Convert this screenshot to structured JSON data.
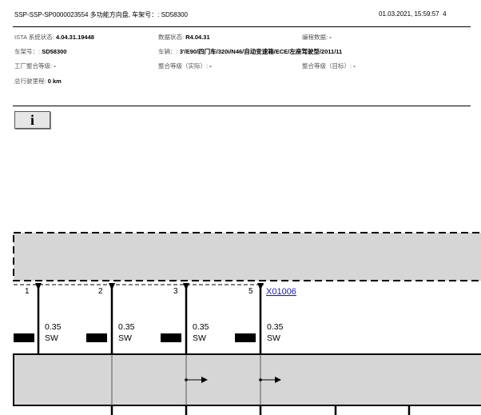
{
  "header": {
    "doc_title": "SSP-SSP-SP0000023554 多功能方向盘, 车架号：: SD58300",
    "datetime": "01.03.2021, 15:59:57",
    "page_no": "4"
  },
  "vehicle_info": {
    "ista_label": "ISTA 系统状态:",
    "ista_value": "4.04.31.19448",
    "data_status_label": "数据状态:",
    "data_status_value": "R4.04.31",
    "programming_label": "编程数据:",
    "programming_value": "-",
    "vin_label": "车架号：:",
    "vin_value": "SD58300",
    "vehicle_label": "车辆：:",
    "vehicle_value": "3'/E90/四门车/320i/N46/自动变速箱/ECE/左座驾驶型/2011/11",
    "factory_level_label": "工厂整合等级:",
    "factory_level_value": "-",
    "actual_level_label": "整合等级（实际）:",
    "actual_level_value": "-",
    "target_level_label": "整合等级（目标）:",
    "target_level_value": "-",
    "mileage_label": "总行驶里程:",
    "mileage_value": "0 km"
  },
  "info_button": {
    "label": "i"
  },
  "wiring": {
    "connector_link": "X01006",
    "pins": [
      {
        "number": "1",
        "gauge": "0.35",
        "color_code": "SW"
      },
      {
        "number": "2",
        "gauge": "0.35",
        "color_code": "SW"
      },
      {
        "number": "3",
        "gauge": "0.35",
        "color_code": "SW"
      },
      {
        "number": "5",
        "gauge": "0.35",
        "color_code": "SW"
      }
    ]
  }
}
